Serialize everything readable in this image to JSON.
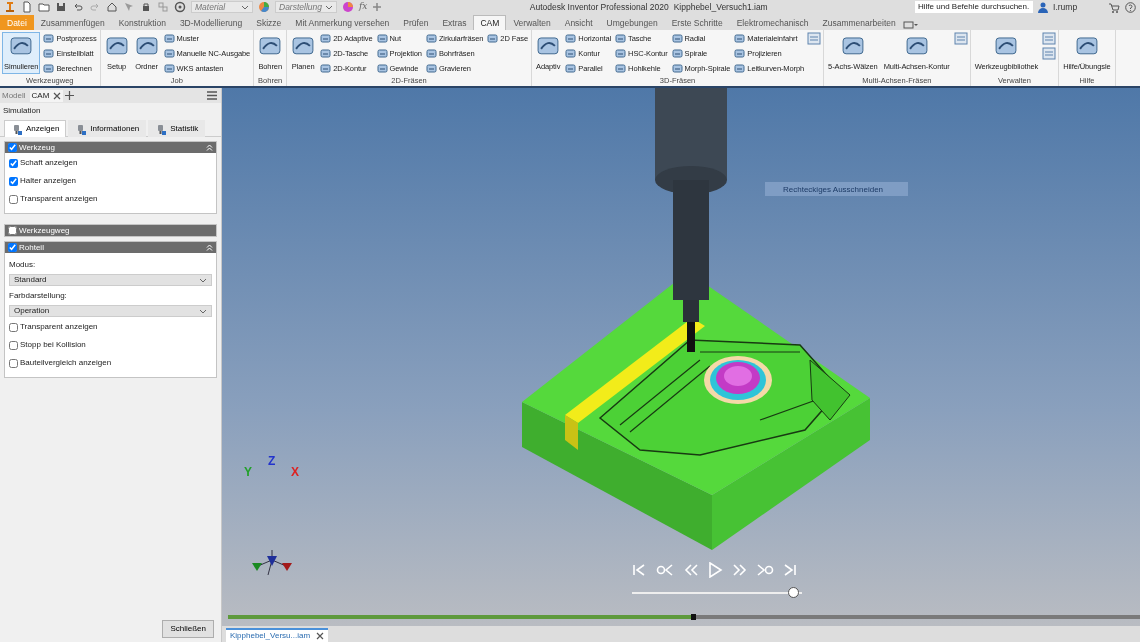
{
  "title_bar": {
    "material": "Material",
    "appearance": "Darstellung",
    "formula": "fx",
    "app_title": "Autodesk Inventor Professional 2020",
    "document_title": "Kipphebel_Versuch1.iam",
    "search": {
      "placeholder": "Hilfe und Befehle durchsuchen.."
    },
    "user": "I.rump"
  },
  "menu_tabs": [
    {
      "label": "Datei",
      "kind": "file",
      "selected": false
    },
    {
      "label": "Zusammenfügen",
      "kind": "tab",
      "selected": false
    },
    {
      "label": "Konstruktion",
      "kind": "tab",
      "selected": false
    },
    {
      "label": "3D-Modellierung",
      "kind": "tab",
      "selected": false
    },
    {
      "label": "Skizze",
      "kind": "tab",
      "selected": false
    },
    {
      "label": "Mit Anmerkung versehen",
      "kind": "tab",
      "selected": false
    },
    {
      "label": "Prüfen",
      "kind": "tab",
      "selected": false
    },
    {
      "label": "Extras",
      "kind": "tab",
      "selected": false
    },
    {
      "label": "CAM",
      "kind": "tab",
      "selected": true
    },
    {
      "label": "Verwalten",
      "kind": "tab",
      "selected": false
    },
    {
      "label": "Ansicht",
      "kind": "tab",
      "selected": false
    },
    {
      "label": "Umgebungen",
      "kind": "tab",
      "selected": false
    },
    {
      "label": "Erste Schritte",
      "kind": "tab",
      "selected": false
    },
    {
      "label": "Elektromechanisch",
      "kind": "tab",
      "selected": false
    },
    {
      "label": "Zusammenarbeiten",
      "kind": "tab",
      "selected": false
    }
  ],
  "ribbon_groups": [
    {
      "title": "Werkzeugweg",
      "columns": [
        {
          "kind": "large",
          "label": "Simulieren",
          "active": true
        },
        {
          "kind": "small",
          "items": [
            "Postprozess",
            "Einstellblatt",
            "Berechnen"
          ]
        }
      ]
    },
    {
      "title": "Job",
      "columns": [
        {
          "kind": "large",
          "label": "Setup",
          "active": false
        },
        {
          "kind": "large",
          "label": "Ordner",
          "active": false
        },
        {
          "kind": "small",
          "items": [
            "Muster",
            "Manuelle NC-Ausgabe",
            "WKS antasten"
          ]
        }
      ]
    },
    {
      "title": "Bohren",
      "columns": [
        {
          "kind": "large",
          "label": "Bohren",
          "active": false
        }
      ]
    },
    {
      "title": "2D-Fräsen",
      "columns": [
        {
          "kind": "large",
          "label": "Planen",
          "active": false
        },
        {
          "kind": "small",
          "items": [
            "2D Adaptive",
            "2D-Tasche",
            "2D-Kontur"
          ]
        },
        {
          "kind": "small",
          "items": [
            "Nut",
            "Projektion",
            "Gewinde"
          ]
        },
        {
          "kind": "small",
          "items": [
            "Zirkularfräsen",
            "Bohrfräsen",
            "Gravieren"
          ]
        },
        {
          "kind": "small",
          "items": [
            "2D Fase"
          ]
        }
      ]
    },
    {
      "title": "3D-Fräsen",
      "columns": [
        {
          "kind": "large",
          "label": "Adaptiv",
          "active": false
        },
        {
          "kind": "small",
          "items": [
            "Horizontal",
            "Kontur",
            "Parallel"
          ]
        },
        {
          "kind": "small",
          "items": [
            "Tasche",
            "HSC-Kontur",
            "Hohlkehle"
          ]
        },
        {
          "kind": "small",
          "items": [
            "Radial",
            "Spirale",
            "Morph-Spirale"
          ]
        },
        {
          "kind": "small",
          "items": [
            "Materialeinfahrt",
            "Projizieren",
            "Leitkurven-Morph"
          ]
        },
        {
          "kind": "icons",
          "items": [
            {
              "active": false
            }
          ]
        }
      ]
    },
    {
      "title": "Multi-Achsen-Fräsen",
      "columns": [
        {
          "kind": "large",
          "label": "5-Achs-Wälzen",
          "active": false
        },
        {
          "kind": "large",
          "label": "Multi-Achsen-Kontur",
          "active": false
        },
        {
          "kind": "icons",
          "items": [
            {
              "active": false
            }
          ]
        }
      ]
    },
    {
      "title": "Verwalten",
      "columns": [
        {
          "kind": "large",
          "label": "Werkzeugbibliothek",
          "active": false
        },
        {
          "kind": "icons",
          "items": [
            {
              "active": false
            },
            {
              "active": false
            }
          ]
        }
      ]
    },
    {
      "title": "Hilfe",
      "columns": [
        {
          "kind": "large",
          "label": "Hilfe/Übungsle",
          "active": false
        }
      ]
    }
  ],
  "browser_tabs": [
    {
      "label": "Modell",
      "selected": false,
      "closable": false
    },
    {
      "label": "CAM",
      "selected": true,
      "closable": true
    }
  ],
  "panel": {
    "title": "Simulation",
    "tabs": [
      {
        "label": "Anzeigen",
        "selected": true
      },
      {
        "label": "Informationen",
        "selected": false
      },
      {
        "label": "Statistik",
        "selected": false
      }
    ],
    "sections": [
      {
        "title": "Werkzeug",
        "checked": true,
        "expanded": true,
        "options": [
          {
            "label": "Schaft anzeigen",
            "checked": true
          },
          {
            "label": "Halter anzeigen",
            "checked": true
          },
          {
            "label": "Transparent anzeigen",
            "checked": false
          }
        ]
      },
      {
        "title": "Werkzeugweg",
        "checked": false,
        "expanded": false
      },
      {
        "title": "Rohteil",
        "checked": true,
        "expanded": true,
        "fields": [
          {
            "label": "Modus:",
            "value": "Standard"
          },
          {
            "label": "Farbdarstellung:",
            "value": "Operation"
          }
        ],
        "options": [
          {
            "label": "Transparent anzeigen",
            "checked": false
          },
          {
            "label": "Stopp bei Kollision",
            "checked": false
          },
          {
            "label": "Bauteilvergleich anzeigen",
            "checked": false
          }
        ]
      }
    ],
    "close_button": "Schließen"
  },
  "viewport": {
    "tooltip": "Rechteckiges Ausschneiden",
    "axes": [
      {
        "label": "Y",
        "color": "#22a02a"
      },
      {
        "label": "Z",
        "color": "#2233cc"
      },
      {
        "label": "X",
        "color": "#dd2222"
      }
    ],
    "speed": {
      "level": 0.95
    },
    "timeline": {
      "level": 0.51
    }
  },
  "document_tabs": [
    {
      "label": "Kipphebel_Versu...iam",
      "selected": true
    }
  ]
}
